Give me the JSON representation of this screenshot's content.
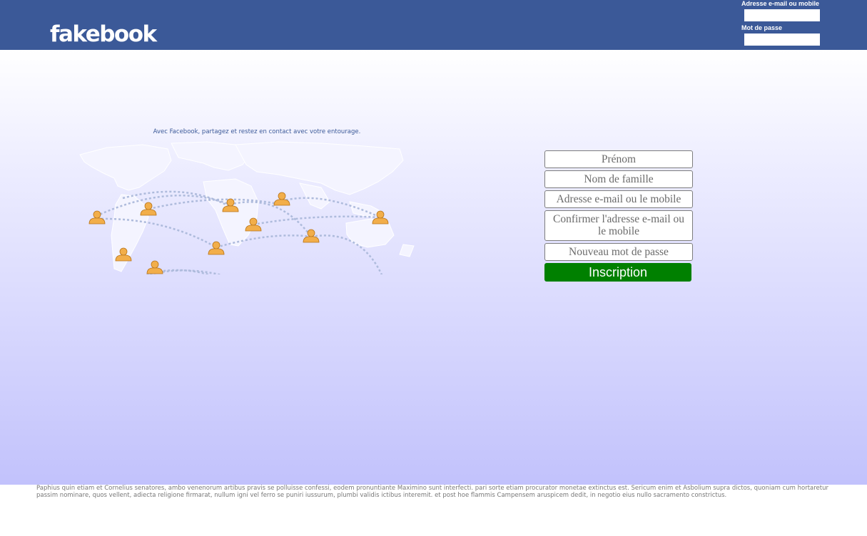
{
  "header": {
    "logo_text": "fakebook",
    "login": {
      "email_label": "Adresse e-mail ou mobile",
      "password_label": "Mot de passe",
      "email_value": "",
      "password_value": ""
    },
    "background_color": "#3b5998"
  },
  "main": {
    "tagline": "Avec Facebook, partagez et restez en contact avec votre entourage.",
    "map_icon": "world-map-people-icon"
  },
  "signup": {
    "first_name_placeholder": "Prénom",
    "last_name_placeholder": "Nom de famille",
    "email_placeholder": "Adresse e-mail ou le mobile",
    "confirm_email_placeholder": "Confirmer l'adresse e-mail ou le mobile",
    "new_password_placeholder": "Nouveau mot de passe",
    "submit_label": "Inscription",
    "submit_color": "#008000"
  },
  "footer": {
    "text": "Paphius quin etiam et Cornelius senatores, ambo venenorum artibus pravis se polluisse confessi, eodem pronuntiante Maximino sunt interfecti. pari sorte etiam procurator monetae extinctus est. Sericum enim et Asbolium supra dictos, quoniam cum hortaretur passim nominare, quos vellent, adiecta religione firmarat, nullum igni vel ferro se puniri iussurum, plumbi validis ictibus interemit. et post hoe flammis Campensem aruspicem dedit, in negotio eius nullo sacramento constrictus."
  }
}
